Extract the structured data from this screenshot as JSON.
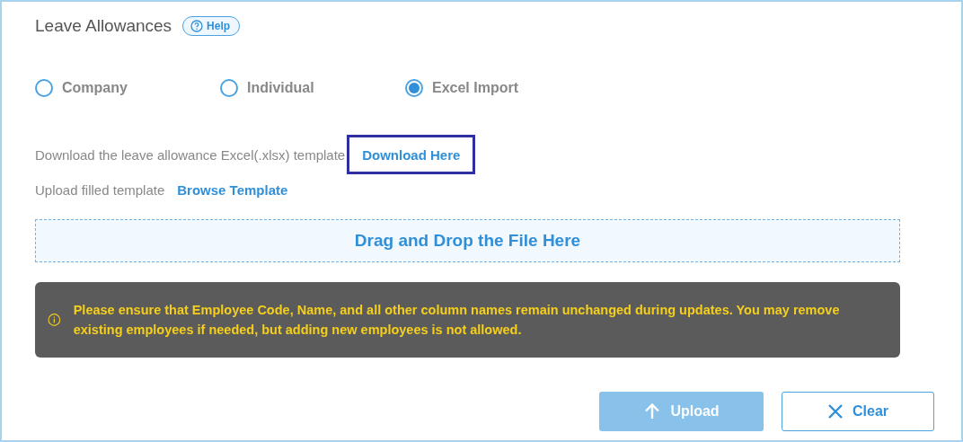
{
  "title": "Leave Allowances",
  "help_button": {
    "label": "Help"
  },
  "modes": [
    {
      "label": "Company",
      "selected": false
    },
    {
      "label": "Individual",
      "selected": false
    },
    {
      "label": "Excel Import",
      "selected": true
    }
  ],
  "download": {
    "text": "Download the leave allowance Excel(.xlsx) template",
    "link": "Download Here",
    "focused": true
  },
  "upload": {
    "text": "Upload filled template",
    "link": "Browse Template"
  },
  "dropzone": {
    "label": "Drag and Drop the File Here"
  },
  "warning": "Please ensure that Employee Code, Name, and all other column names remain unchanged during updates. You may remove existing employees if needed, but adding new employees is not allowed.",
  "buttons": [
    {
      "kind": "upload",
      "label": "Upload",
      "disabled": true
    },
    {
      "kind": "clear",
      "label": "Clear",
      "disabled": false
    }
  ]
}
